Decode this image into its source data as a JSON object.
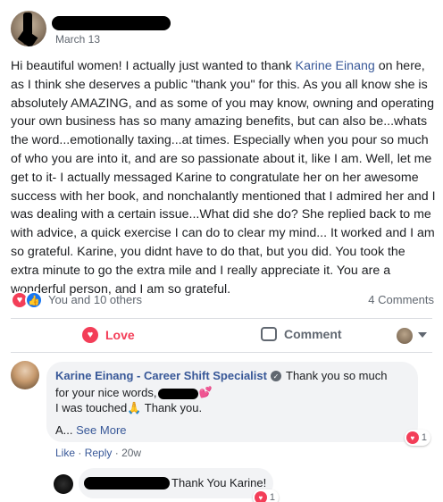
{
  "post": {
    "date": "March 13",
    "body_before_mention": "Hi beautiful women! I actually just wanted to thank ",
    "mention": "Karine Einang",
    "body_after_mention": " on here, as I think she deserves a public \"thank you\" for this. As you all know she is absolutely AMAZING, and as some of you may know, owning and operating your own business has so many amazing benefits, but can also be...whats the word...emotionally taxing...at times. Especially when you pour so much of who you are into it, and are so passionate about it, like I am. Well, let me get to it- I actually messaged Karine to congratulate her on her awesome success with her book, and nonchalantly mentioned that I admired her and I was dealing with a certain issue...What did she do? She replied back to me with advice, a quick exercise I can do to clear my mind... It worked and I am so grateful. Karine, you didnt have to do that, but you did. You took the extra minute to go the extra mile and I really appreciate it. You are a wonderful person, and I am so grateful."
  },
  "reactions": {
    "summary": "You and 10 others",
    "comments_count": "4 Comments",
    "icons": [
      "heart-icon",
      "like-icon"
    ]
  },
  "actions": {
    "love_label": "Love",
    "comment_label": "Comment"
  },
  "comment1": {
    "author": "Karine Einang - Career Shift Specialist",
    "text1": "Thank you so much",
    "text2_before": "for your nice words,",
    "text3_before": "I was touched",
    "text3_emoji": "🙏",
    "text3_after": " Thank you.",
    "text4": "A...",
    "see_more": "See More",
    "reaction_count": "1",
    "like": "Like",
    "reply": "Reply",
    "sep": "·",
    "time": "20w"
  },
  "reply1": {
    "text": "Thank You Karine!",
    "reaction_count": "1"
  },
  "colors": {
    "link": "#385898",
    "love": "#f33e58",
    "like": "#1877f2",
    "muted": "#606770",
    "bubble": "#f2f3f5"
  }
}
